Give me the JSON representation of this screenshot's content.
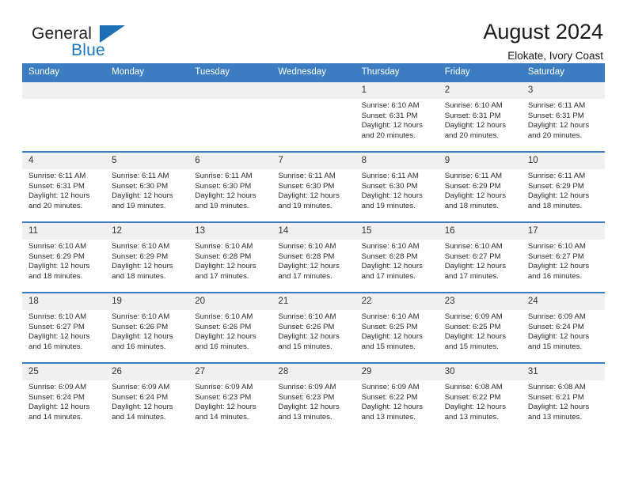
{
  "brand": {
    "word_one": "General",
    "word_two": "Blue",
    "triangle_color": "#1b6fb4"
  },
  "header": {
    "title": "August 2024",
    "subtitle": "Elokate, Ivory Coast",
    "header_bg": "#3b7dc0",
    "daynum_bg": "#f0f0f0"
  },
  "weekdays": [
    "Sunday",
    "Monday",
    "Tuesday",
    "Wednesday",
    "Thursday",
    "Friday",
    "Saturday"
  ],
  "labels": {
    "sunrise": "Sunrise:",
    "sunset": "Sunset:",
    "daylight": "Daylight:"
  },
  "weeks": [
    [
      {
        "day": "",
        "sunrise": "",
        "sunset": "",
        "daylight_line1": "",
        "daylight_line2": ""
      },
      {
        "day": "",
        "sunrise": "",
        "sunset": "",
        "daylight_line1": "",
        "daylight_line2": ""
      },
      {
        "day": "",
        "sunrise": "",
        "sunset": "",
        "daylight_line1": "",
        "daylight_line2": ""
      },
      {
        "day": "",
        "sunrise": "",
        "sunset": "",
        "daylight_line1": "",
        "daylight_line2": ""
      },
      {
        "day": "1",
        "sunrise": "Sunrise: 6:10 AM",
        "sunset": "Sunset: 6:31 PM",
        "daylight_line1": "Daylight: 12 hours",
        "daylight_line2": "and 20 minutes."
      },
      {
        "day": "2",
        "sunrise": "Sunrise: 6:10 AM",
        "sunset": "Sunset: 6:31 PM",
        "daylight_line1": "Daylight: 12 hours",
        "daylight_line2": "and 20 minutes."
      },
      {
        "day": "3",
        "sunrise": "Sunrise: 6:11 AM",
        "sunset": "Sunset: 6:31 PM",
        "daylight_line1": "Daylight: 12 hours",
        "daylight_line2": "and 20 minutes."
      }
    ],
    [
      {
        "day": "4",
        "sunrise": "Sunrise: 6:11 AM",
        "sunset": "Sunset: 6:31 PM",
        "daylight_line1": "Daylight: 12 hours",
        "daylight_line2": "and 20 minutes."
      },
      {
        "day": "5",
        "sunrise": "Sunrise: 6:11 AM",
        "sunset": "Sunset: 6:30 PM",
        "daylight_line1": "Daylight: 12 hours",
        "daylight_line2": "and 19 minutes."
      },
      {
        "day": "6",
        "sunrise": "Sunrise: 6:11 AM",
        "sunset": "Sunset: 6:30 PM",
        "daylight_line1": "Daylight: 12 hours",
        "daylight_line2": "and 19 minutes."
      },
      {
        "day": "7",
        "sunrise": "Sunrise: 6:11 AM",
        "sunset": "Sunset: 6:30 PM",
        "daylight_line1": "Daylight: 12 hours",
        "daylight_line2": "and 19 minutes."
      },
      {
        "day": "8",
        "sunrise": "Sunrise: 6:11 AM",
        "sunset": "Sunset: 6:30 PM",
        "daylight_line1": "Daylight: 12 hours",
        "daylight_line2": "and 19 minutes."
      },
      {
        "day": "9",
        "sunrise": "Sunrise: 6:11 AM",
        "sunset": "Sunset: 6:29 PM",
        "daylight_line1": "Daylight: 12 hours",
        "daylight_line2": "and 18 minutes."
      },
      {
        "day": "10",
        "sunrise": "Sunrise: 6:11 AM",
        "sunset": "Sunset: 6:29 PM",
        "daylight_line1": "Daylight: 12 hours",
        "daylight_line2": "and 18 minutes."
      }
    ],
    [
      {
        "day": "11",
        "sunrise": "Sunrise: 6:10 AM",
        "sunset": "Sunset: 6:29 PM",
        "daylight_line1": "Daylight: 12 hours",
        "daylight_line2": "and 18 minutes."
      },
      {
        "day": "12",
        "sunrise": "Sunrise: 6:10 AM",
        "sunset": "Sunset: 6:29 PM",
        "daylight_line1": "Daylight: 12 hours",
        "daylight_line2": "and 18 minutes."
      },
      {
        "day": "13",
        "sunrise": "Sunrise: 6:10 AM",
        "sunset": "Sunset: 6:28 PM",
        "daylight_line1": "Daylight: 12 hours",
        "daylight_line2": "and 17 minutes."
      },
      {
        "day": "14",
        "sunrise": "Sunrise: 6:10 AM",
        "sunset": "Sunset: 6:28 PM",
        "daylight_line1": "Daylight: 12 hours",
        "daylight_line2": "and 17 minutes."
      },
      {
        "day": "15",
        "sunrise": "Sunrise: 6:10 AM",
        "sunset": "Sunset: 6:28 PM",
        "daylight_line1": "Daylight: 12 hours",
        "daylight_line2": "and 17 minutes."
      },
      {
        "day": "16",
        "sunrise": "Sunrise: 6:10 AM",
        "sunset": "Sunset: 6:27 PM",
        "daylight_line1": "Daylight: 12 hours",
        "daylight_line2": "and 17 minutes."
      },
      {
        "day": "17",
        "sunrise": "Sunrise: 6:10 AM",
        "sunset": "Sunset: 6:27 PM",
        "daylight_line1": "Daylight: 12 hours",
        "daylight_line2": "and 16 minutes."
      }
    ],
    [
      {
        "day": "18",
        "sunrise": "Sunrise: 6:10 AM",
        "sunset": "Sunset: 6:27 PM",
        "daylight_line1": "Daylight: 12 hours",
        "daylight_line2": "and 16 minutes."
      },
      {
        "day": "19",
        "sunrise": "Sunrise: 6:10 AM",
        "sunset": "Sunset: 6:26 PM",
        "daylight_line1": "Daylight: 12 hours",
        "daylight_line2": "and 16 minutes."
      },
      {
        "day": "20",
        "sunrise": "Sunrise: 6:10 AM",
        "sunset": "Sunset: 6:26 PM",
        "daylight_line1": "Daylight: 12 hours",
        "daylight_line2": "and 16 minutes."
      },
      {
        "day": "21",
        "sunrise": "Sunrise: 6:10 AM",
        "sunset": "Sunset: 6:26 PM",
        "daylight_line1": "Daylight: 12 hours",
        "daylight_line2": "and 15 minutes."
      },
      {
        "day": "22",
        "sunrise": "Sunrise: 6:10 AM",
        "sunset": "Sunset: 6:25 PM",
        "daylight_line1": "Daylight: 12 hours",
        "daylight_line2": "and 15 minutes."
      },
      {
        "day": "23",
        "sunrise": "Sunrise: 6:09 AM",
        "sunset": "Sunset: 6:25 PM",
        "daylight_line1": "Daylight: 12 hours",
        "daylight_line2": "and 15 minutes."
      },
      {
        "day": "24",
        "sunrise": "Sunrise: 6:09 AM",
        "sunset": "Sunset: 6:24 PM",
        "daylight_line1": "Daylight: 12 hours",
        "daylight_line2": "and 15 minutes."
      }
    ],
    [
      {
        "day": "25",
        "sunrise": "Sunrise: 6:09 AM",
        "sunset": "Sunset: 6:24 PM",
        "daylight_line1": "Daylight: 12 hours",
        "daylight_line2": "and 14 minutes."
      },
      {
        "day": "26",
        "sunrise": "Sunrise: 6:09 AM",
        "sunset": "Sunset: 6:24 PM",
        "daylight_line1": "Daylight: 12 hours",
        "daylight_line2": "and 14 minutes."
      },
      {
        "day": "27",
        "sunrise": "Sunrise: 6:09 AM",
        "sunset": "Sunset: 6:23 PM",
        "daylight_line1": "Daylight: 12 hours",
        "daylight_line2": "and 14 minutes."
      },
      {
        "day": "28",
        "sunrise": "Sunrise: 6:09 AM",
        "sunset": "Sunset: 6:23 PM",
        "daylight_line1": "Daylight: 12 hours",
        "daylight_line2": "and 13 minutes."
      },
      {
        "day": "29",
        "sunrise": "Sunrise: 6:09 AM",
        "sunset": "Sunset: 6:22 PM",
        "daylight_line1": "Daylight: 12 hours",
        "daylight_line2": "and 13 minutes."
      },
      {
        "day": "30",
        "sunrise": "Sunrise: 6:08 AM",
        "sunset": "Sunset: 6:22 PM",
        "daylight_line1": "Daylight: 12 hours",
        "daylight_line2": "and 13 minutes."
      },
      {
        "day": "31",
        "sunrise": "Sunrise: 6:08 AM",
        "sunset": "Sunset: 6:21 PM",
        "daylight_line1": "Daylight: 12 hours",
        "daylight_line2": "and 13 minutes."
      }
    ]
  ]
}
